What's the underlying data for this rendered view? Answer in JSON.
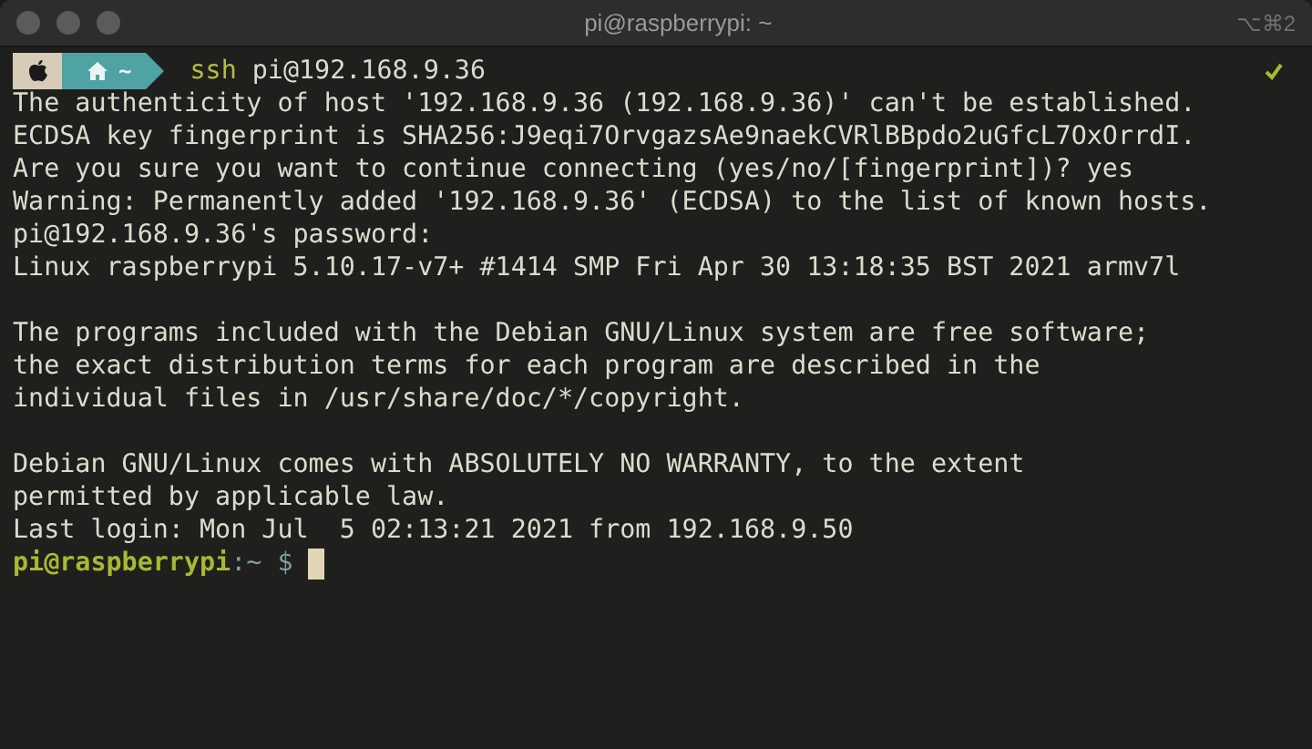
{
  "window": {
    "title": "pi@raspberrypi: ~",
    "shortcut": "⌥⌘2"
  },
  "prompt": {
    "path": "~",
    "command": "ssh",
    "argument": "pi@192.168.9.36"
  },
  "output": [
    [
      "The authenticity of host '192.168.9.36 (192.168.9.36)' can't be established.",
      "ECDSA key fingerprint is SHA256:J9eqi7OrvgazsAe9naekCVRlBBpdo2uGfcL7OxOrrdI.",
      "Are you sure you want to continue connecting (yes/no/[fingerprint])? yes",
      "Warning: Permanently added '192.168.9.36' (ECDSA) to the list of known hosts.",
      "pi@192.168.9.36's password:",
      "Linux raspberrypi 5.10.17-v7+ #1414 SMP Fri Apr 30 13:18:35 BST 2021 armv7l"
    ],
    [
      "The programs included with the Debian GNU/Linux system are free software;",
      "the exact distribution terms for each program are described in the",
      "individual files in /usr/share/doc/*/copyright."
    ],
    [
      "Debian GNU/Linux comes with ABSOLUTELY NO WARRANTY, to the extent",
      "permitted by applicable law.",
      "Last login: Mon Jul  5 02:13:21 2021 from 192.168.9.50"
    ]
  ],
  "remote_prompt": {
    "user_host": "pi@raspberrypi",
    "separator": ":",
    "path": "~",
    "symbol": "$"
  }
}
